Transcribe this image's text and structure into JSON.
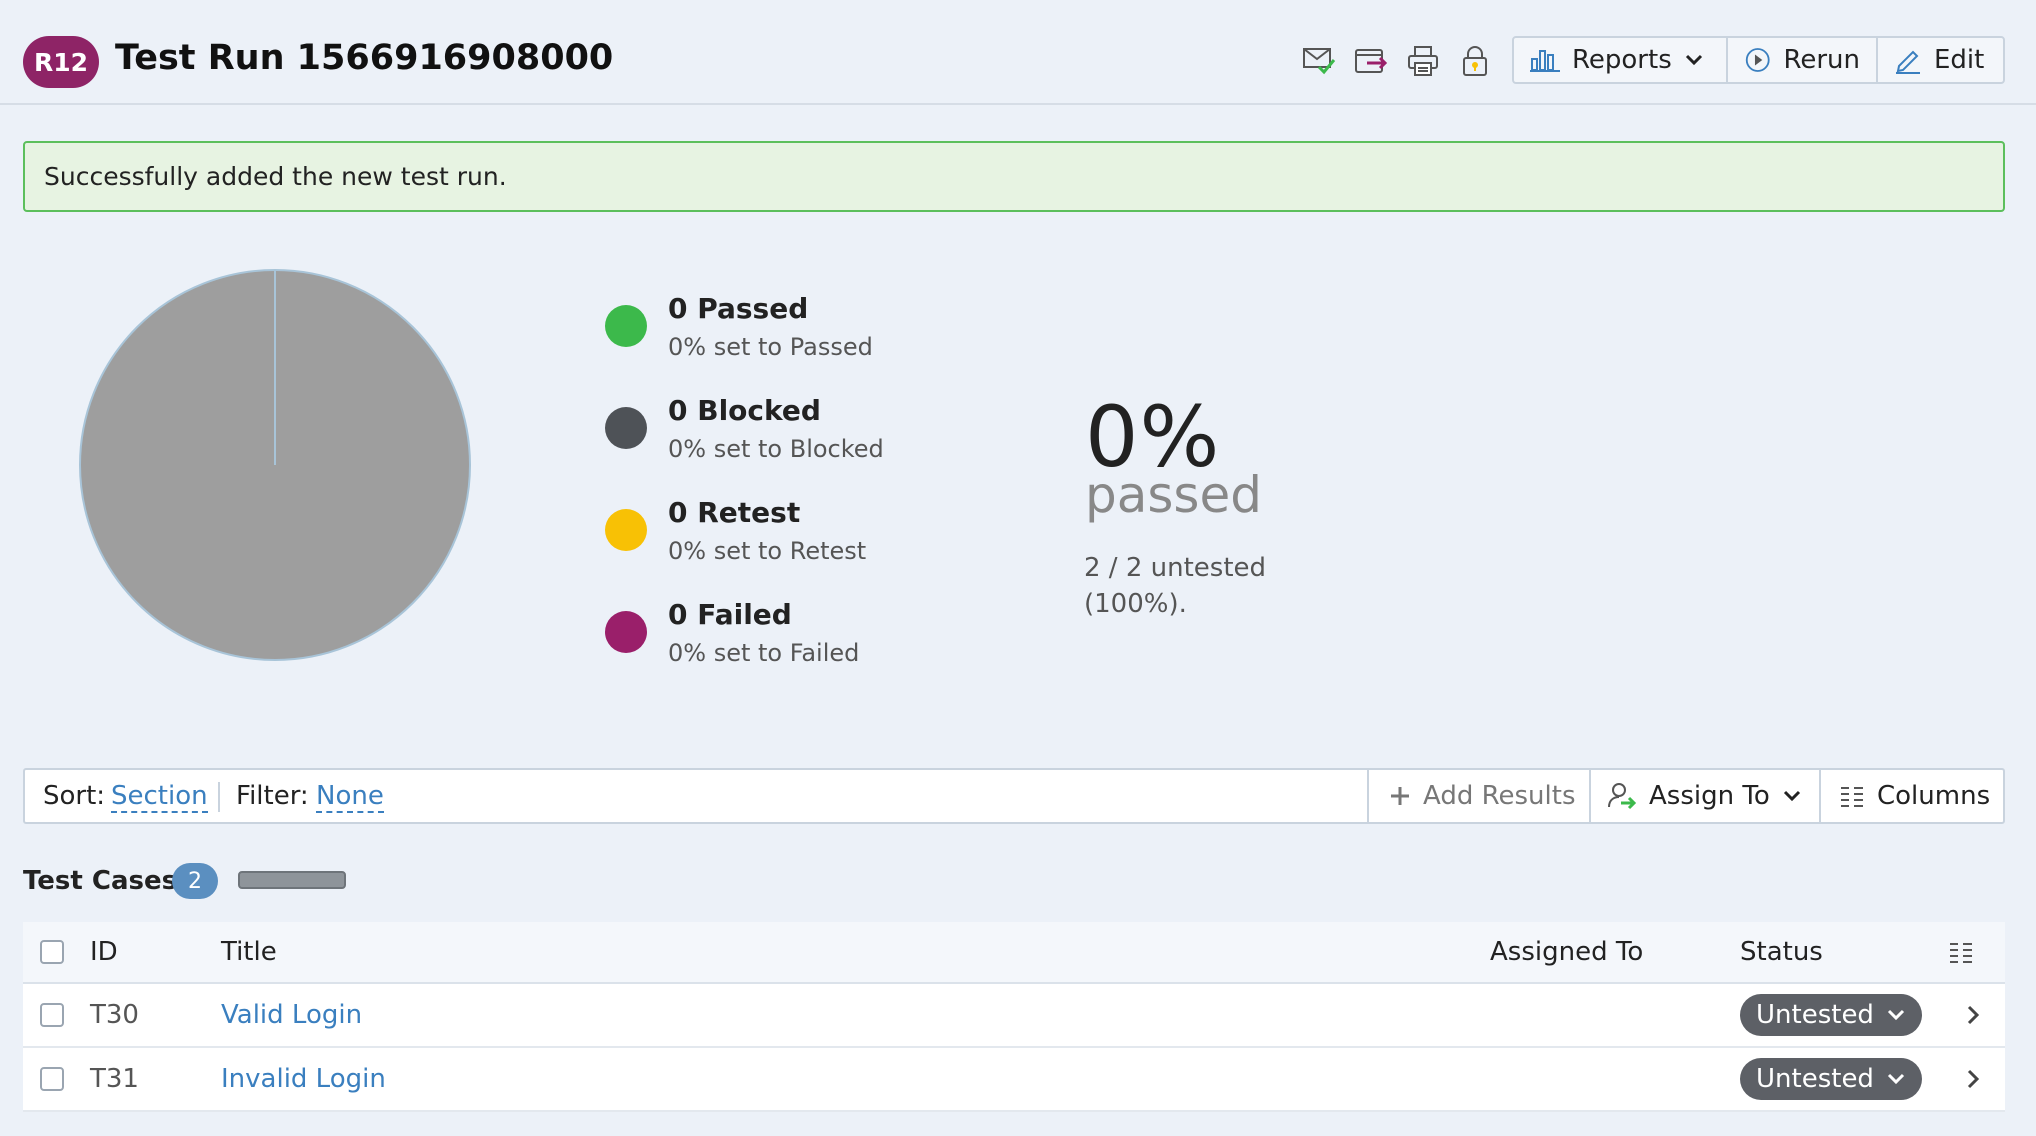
{
  "header": {
    "badge": "R12",
    "title": "Test Run 1566916908000",
    "icons": [
      "mail-check-icon",
      "export-icon",
      "print-icon",
      "lock-icon"
    ],
    "buttons": {
      "reports": "Reports",
      "rerun": "Rerun",
      "edit": "Edit"
    }
  },
  "alert": {
    "message": "Successfully added the new test run.",
    "color": "#5cbf5c"
  },
  "summary": {
    "pie_color": "#9e9e9e",
    "legend": [
      {
        "title": "0 Passed",
        "sub": "0% set to Passed",
        "color": "#3cb94b"
      },
      {
        "title": "0 Blocked",
        "sub": "0% set to Blocked",
        "color": "#4e5257"
      },
      {
        "title": "0 Retest",
        "sub": "0% set to Retest",
        "color": "#f8c105"
      },
      {
        "title": "0 Failed",
        "sub": "0% set to Failed",
        "color": "#9a1f6a"
      }
    ],
    "percent": "0%",
    "percent_label": "passed",
    "untested": "2 / 2 untested (100%)."
  },
  "toolbar": {
    "sort_label": "Sort:",
    "sort_value": "Section",
    "filter_label": "Filter:",
    "filter_value": "None",
    "add_results": "Add Results",
    "assign_to": "Assign To",
    "columns": "Columns"
  },
  "test_cases": {
    "title": "Test Cases",
    "count": "2",
    "columns": {
      "id": "ID",
      "title": "Title",
      "assigned_to": "Assigned To",
      "status": "Status"
    },
    "rows": [
      {
        "id": "T30",
        "title": "Valid Login",
        "assigned_to": "",
        "status": "Untested"
      },
      {
        "id": "T31",
        "title": "Invalid Login",
        "assigned_to": "",
        "status": "Untested"
      }
    ]
  }
}
